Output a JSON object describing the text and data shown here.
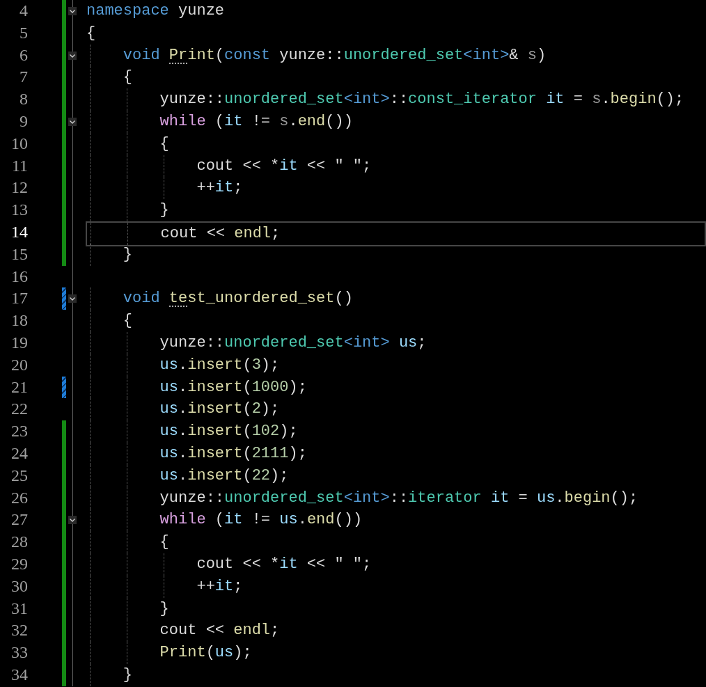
{
  "lines": [
    {
      "number": "4",
      "current": false,
      "fold": true,
      "modified": true,
      "saved": true,
      "tokens": [
        {
          "kind": "kw",
          "text": "namespace"
        },
        {
          "kind": "plain",
          "text": " yunze"
        }
      ]
    },
    {
      "number": "5",
      "current": false,
      "fold": false,
      "modified": true,
      "saved": true,
      "tokens": [
        {
          "kind": "plain",
          "text": "{"
        }
      ]
    },
    {
      "number": "6",
      "current": false,
      "fold": true,
      "modified": true,
      "saved": true,
      "tokens": [
        {
          "kind": "kw",
          "text": "    void "
        },
        {
          "kind": "fn",
          "text": "Print",
          "hint": true
        },
        {
          "kind": "plain",
          "text": "("
        },
        {
          "kind": "kw",
          "text": "const"
        },
        {
          "kind": "plain",
          "text": " yunze::"
        },
        {
          "kind": "type",
          "text": "unordered_set"
        },
        {
          "kind": "kw",
          "text": "<int>"
        },
        {
          "kind": "plain",
          "text": "& "
        },
        {
          "kind": "param",
          "text": "s"
        },
        {
          "kind": "plain",
          "text": ")"
        }
      ]
    },
    {
      "number": "7",
      "current": false,
      "fold": false,
      "modified": true,
      "saved": true,
      "tokens": [
        {
          "kind": "plain",
          "text": "    {"
        }
      ]
    },
    {
      "number": "8",
      "current": false,
      "fold": false,
      "modified": true,
      "saved": true,
      "tokens": [
        {
          "kind": "plain",
          "text": "        yunze::"
        },
        {
          "kind": "type",
          "text": "unordered_set"
        },
        {
          "kind": "kw",
          "text": "<int>"
        },
        {
          "kind": "plain",
          "text": "::"
        },
        {
          "kind": "type",
          "text": "const_iterator "
        },
        {
          "kind": "var",
          "text": "it"
        },
        {
          "kind": "plain",
          "text": " = "
        },
        {
          "kind": "param",
          "text": "s"
        },
        {
          "kind": "plain",
          "text": "."
        },
        {
          "kind": "fn",
          "text": "begin"
        },
        {
          "kind": "plain",
          "text": "();"
        }
      ]
    },
    {
      "number": "9",
      "current": false,
      "fold": true,
      "modified": true,
      "saved": true,
      "tokens": [
        {
          "kind": "ctrl",
          "text": "        while"
        },
        {
          "kind": "plain",
          "text": " ("
        },
        {
          "kind": "var",
          "text": "it"
        },
        {
          "kind": "plain",
          "text": " != "
        },
        {
          "kind": "param",
          "text": "s"
        },
        {
          "kind": "plain",
          "text": "."
        },
        {
          "kind": "fn",
          "text": "end"
        },
        {
          "kind": "plain",
          "text": "())"
        }
      ]
    },
    {
      "number": "10",
      "current": false,
      "fold": false,
      "modified": true,
      "saved": true,
      "tokens": [
        {
          "kind": "plain",
          "text": "        {"
        }
      ]
    },
    {
      "number": "11",
      "current": false,
      "fold": false,
      "modified": true,
      "saved": true,
      "tokens": [
        {
          "kind": "plain",
          "text": "            cout << *"
        },
        {
          "kind": "var",
          "text": "it"
        },
        {
          "kind": "plain",
          "text": " << \" \";"
        }
      ]
    },
    {
      "number": "12",
      "current": false,
      "fold": false,
      "modified": true,
      "saved": true,
      "tokens": [
        {
          "kind": "plain",
          "text": "            ++"
        },
        {
          "kind": "var",
          "text": "it"
        },
        {
          "kind": "plain",
          "text": ";"
        }
      ]
    },
    {
      "number": "13",
      "current": false,
      "fold": false,
      "modified": true,
      "saved": true,
      "tokens": [
        {
          "kind": "plain",
          "text": "        }"
        }
      ]
    },
    {
      "number": "14",
      "current": true,
      "fold": false,
      "modified": true,
      "saved": true,
      "tokens": [
        {
          "kind": "plain",
          "text": "        cout << "
        },
        {
          "kind": "fn",
          "text": "endl"
        },
        {
          "kind": "plain",
          "text": ";"
        }
      ]
    },
    {
      "number": "15",
      "current": false,
      "fold": false,
      "modified": true,
      "saved": true,
      "tokens": [
        {
          "kind": "plain",
          "text": "    }"
        }
      ]
    },
    {
      "number": "16",
      "current": false,
      "fold": false,
      "modified": false
    },
    {
      "number": "17",
      "current": false,
      "fold": true,
      "modified": true,
      "saved": false,
      "tokens": [
        {
          "kind": "kw",
          "text": "    void "
        },
        {
          "kind": "fn",
          "text": "test_unordered_set",
          "hint": true
        },
        {
          "kind": "plain",
          "text": "()"
        }
      ]
    },
    {
      "number": "18",
      "current": false,
      "fold": false,
      "modified": false,
      "tokens": [
        {
          "kind": "plain",
          "text": "    {"
        }
      ]
    },
    {
      "number": "19",
      "current": false,
      "fold": false,
      "modified": false,
      "tokens": [
        {
          "kind": "plain",
          "text": "        yunze::"
        },
        {
          "kind": "type",
          "text": "unordered_set"
        },
        {
          "kind": "kw",
          "text": "<int>"
        },
        {
          "kind": "var",
          "text": " us"
        },
        {
          "kind": "plain",
          "text": ";"
        }
      ]
    },
    {
      "number": "20",
      "current": false,
      "fold": false,
      "modified": false,
      "tokens": [
        {
          "kind": "var",
          "text": "        us"
        },
        {
          "kind": "plain",
          "text": "."
        },
        {
          "kind": "fn",
          "text": "insert"
        },
        {
          "kind": "plain",
          "text": "("
        },
        {
          "kind": "num",
          "text": "3"
        },
        {
          "kind": "plain",
          "text": ");"
        }
      ]
    },
    {
      "number": "21",
      "current": false,
      "fold": false,
      "modified": true,
      "saved": false,
      "tokens": [
        {
          "kind": "var",
          "text": "        us"
        },
        {
          "kind": "plain",
          "text": "."
        },
        {
          "kind": "fn",
          "text": "insert"
        },
        {
          "kind": "plain",
          "text": "("
        },
        {
          "kind": "num",
          "text": "1000"
        },
        {
          "kind": "plain",
          "text": ");"
        }
      ]
    },
    {
      "number": "22",
      "current": false,
      "fold": false,
      "modified": false,
      "tokens": [
        {
          "kind": "var",
          "text": "        us"
        },
        {
          "kind": "plain",
          "text": "."
        },
        {
          "kind": "fn",
          "text": "insert"
        },
        {
          "kind": "plain",
          "text": "("
        },
        {
          "kind": "num",
          "text": "2"
        },
        {
          "kind": "plain",
          "text": ");"
        }
      ]
    },
    {
      "number": "23",
      "current": false,
      "fold": false,
      "modified": true,
      "saved": true,
      "tokens": [
        {
          "kind": "var",
          "text": "        us"
        },
        {
          "kind": "plain",
          "text": "."
        },
        {
          "kind": "fn",
          "text": "insert"
        },
        {
          "kind": "plain",
          "text": "("
        },
        {
          "kind": "num",
          "text": "102"
        },
        {
          "kind": "plain",
          "text": ");"
        }
      ]
    },
    {
      "number": "24",
      "current": false,
      "fold": false,
      "modified": true,
      "saved": true,
      "tokens": [
        {
          "kind": "var",
          "text": "        us"
        },
        {
          "kind": "plain",
          "text": "."
        },
        {
          "kind": "fn",
          "text": "insert"
        },
        {
          "kind": "plain",
          "text": "("
        },
        {
          "kind": "num",
          "text": "2111"
        },
        {
          "kind": "plain",
          "text": ");"
        }
      ]
    },
    {
      "number": "25",
      "current": false,
      "fold": false,
      "modified": true,
      "saved": true,
      "tokens": [
        {
          "kind": "var",
          "text": "        us"
        },
        {
          "kind": "plain",
          "text": "."
        },
        {
          "kind": "fn",
          "text": "insert"
        },
        {
          "kind": "plain",
          "text": "("
        },
        {
          "kind": "num",
          "text": "22"
        },
        {
          "kind": "plain",
          "text": ");"
        }
      ]
    },
    {
      "number": "26",
      "current": false,
      "fold": false,
      "modified": true,
      "saved": true,
      "tokens": [
        {
          "kind": "plain",
          "text": "        yunze::"
        },
        {
          "kind": "type",
          "text": "unordered_set"
        },
        {
          "kind": "kw",
          "text": "<int>"
        },
        {
          "kind": "plain",
          "text": "::"
        },
        {
          "kind": "type",
          "text": "iterator "
        },
        {
          "kind": "var",
          "text": "it"
        },
        {
          "kind": "plain",
          "text": " = "
        },
        {
          "kind": "var",
          "text": "us"
        },
        {
          "kind": "plain",
          "text": "."
        },
        {
          "kind": "fn",
          "text": "begin"
        },
        {
          "kind": "plain",
          "text": "();"
        }
      ]
    },
    {
      "number": "27",
      "current": false,
      "fold": true,
      "modified": true,
      "saved": true,
      "tokens": [
        {
          "kind": "ctrl",
          "text": "        while"
        },
        {
          "kind": "plain",
          "text": " ("
        },
        {
          "kind": "var",
          "text": "it"
        },
        {
          "kind": "plain",
          "text": " != "
        },
        {
          "kind": "var",
          "text": "us"
        },
        {
          "kind": "plain",
          "text": "."
        },
        {
          "kind": "fn",
          "text": "end"
        },
        {
          "kind": "plain",
          "text": "())"
        }
      ]
    },
    {
      "number": "28",
      "current": false,
      "fold": false,
      "modified": true,
      "saved": true,
      "tokens": [
        {
          "kind": "plain",
          "text": "        {"
        }
      ]
    },
    {
      "number": "29",
      "current": false,
      "fold": false,
      "modified": true,
      "saved": true,
      "tokens": [
        {
          "kind": "plain",
          "text": "            cout << *"
        },
        {
          "kind": "var",
          "text": "it"
        },
        {
          "kind": "plain",
          "text": " << \" \";"
        }
      ]
    },
    {
      "number": "30",
      "current": false,
      "fold": false,
      "modified": true,
      "saved": true,
      "tokens": [
        {
          "kind": "plain",
          "text": "            ++"
        },
        {
          "kind": "var",
          "text": "it"
        },
        {
          "kind": "plain",
          "text": ";"
        }
      ]
    },
    {
      "number": "31",
      "current": false,
      "fold": false,
      "modified": true,
      "saved": true,
      "tokens": [
        {
          "kind": "plain",
          "text": "        }"
        }
      ]
    },
    {
      "number": "32",
      "current": false,
      "fold": false,
      "modified": true,
      "saved": true,
      "tokens": [
        {
          "kind": "plain",
          "text": "        cout << "
        },
        {
          "kind": "fn",
          "text": "endl"
        },
        {
          "kind": "plain",
          "text": ";"
        }
      ]
    },
    {
      "number": "33",
      "current": false,
      "fold": false,
      "modified": true,
      "saved": true,
      "tokens": [
        {
          "kind": "fn",
          "text": "        Print"
        },
        {
          "kind": "plain",
          "text": "("
        },
        {
          "kind": "var",
          "text": "us"
        },
        {
          "kind": "plain",
          "text": ");"
        }
      ]
    },
    {
      "number": "34",
      "current": false,
      "fold": false,
      "modified": true,
      "saved": true,
      "tokens": [
        {
          "kind": "plain",
          "text": "    }"
        }
      ]
    }
  ]
}
